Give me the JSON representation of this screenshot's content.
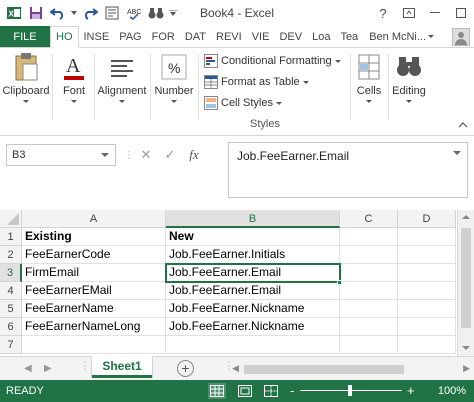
{
  "window": {
    "title": "Book4 - Excel"
  },
  "ribbon_tabs": {
    "file": "FILE",
    "tabs": [
      "HO",
      "INSE",
      "PAG",
      "FOR",
      "DAT",
      "REVI",
      "VIE",
      "DEV",
      "Loa",
      "Tea"
    ],
    "active_index": 0,
    "user": "Ben McNi..."
  },
  "ribbon": {
    "clipboard": "Clipboard",
    "font": "Font",
    "alignment": "Alignment",
    "number": "Number",
    "conditional_formatting": "Conditional Formatting",
    "format_as_table": "Format as Table",
    "cell_styles": "Cell Styles",
    "styles_group": "Styles",
    "cells": "Cells",
    "editing": "Editing"
  },
  "formula_bar": {
    "name_box": "B3",
    "fx": "fx",
    "content": "Job.FeeEarner.Email"
  },
  "grid": {
    "columns": [
      "A",
      "B",
      "C",
      "D"
    ],
    "selected_column": "B",
    "rows": [
      "1",
      "2",
      "3",
      "4",
      "5",
      "6",
      "7"
    ],
    "selected_row": "3",
    "cells": [
      [
        "Existing",
        "New"
      ],
      [
        "FeeEarnerCode",
        "Job.FeeEarner.Initials"
      ],
      [
        "FirmEmail",
        "Job.FeeEarner.Email"
      ],
      [
        "FeeEarnerEMail",
        "Job.FeeEarner.Email"
      ],
      [
        "FeeEarnerName",
        "Job.FeeEarner.Nickname"
      ],
      [
        "FeeEarnerNameLong",
        "Job.FeeEarner.Nickname"
      ],
      [
        "",
        ""
      ]
    ]
  },
  "sheets": {
    "active": "Sheet1"
  },
  "status": {
    "mode": "READY",
    "zoom": "100%",
    "zoom_minus": "-",
    "zoom_plus": "+"
  },
  "colors": {
    "accent": "#217346"
  }
}
